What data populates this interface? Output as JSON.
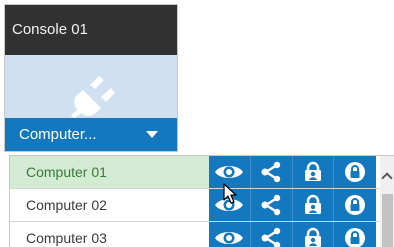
{
  "console_card": {
    "title": "Console 01",
    "icon": "plug-icon",
    "dropdown_value": "Computer..."
  },
  "computer_list": {
    "rows": [
      {
        "label": "Computer 01",
        "selected": true
      },
      {
        "label": "Computer 02",
        "selected": false
      },
      {
        "label": "Computer 03",
        "selected": false
      }
    ],
    "actions": [
      "eye-icon",
      "share-icon",
      "lock-user-icon",
      "lock-icon"
    ]
  },
  "colors": {
    "accent_blue": "#1478be",
    "card_bg": "#cfe0f0",
    "title_bar": "#313131",
    "selected_row_bg": "#d3ebd2"
  }
}
